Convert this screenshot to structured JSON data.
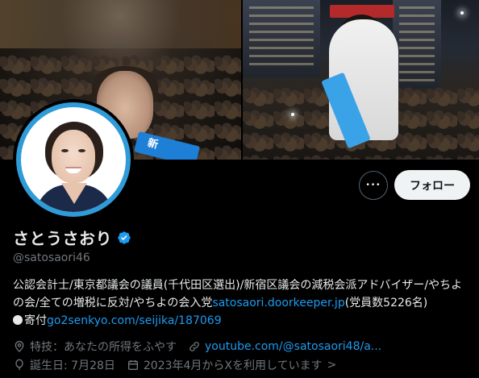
{
  "profile": {
    "display_name": "さとうさおり",
    "handle": "@satosaori46",
    "verified": true,
    "follow_label": "フォロー",
    "more_label": "•••"
  },
  "banner": {
    "left_sash_text": "新"
  },
  "bio": {
    "text1": "公認会計士/東京都議会の議員(千代田区選出)/新宿区議会の減税会派アドバイザー/やちよの会/全ての増税に反対/やちよの会入党",
    "link1": "satosaori.doorkeeper.jp",
    "text2": "(党員数5226名)",
    "text3": "寄付",
    "link2": "go2senkyo.com/seijika/187069"
  },
  "meta": {
    "location": "特技：あなたの所得をふやす",
    "website": "youtube.com/@satosaori48/a...",
    "birthday": "誕生日: 7月28日",
    "joined": "2023年4月からXを利用しています",
    "joined_chevron": ">"
  },
  "colors": {
    "background": "#000000",
    "accent": "#1d9bf0",
    "muted": "#71767b",
    "follow_bg": "#eff3f4"
  },
  "icons": [
    "more-icon",
    "verified-badge-icon",
    "location-icon",
    "link-icon",
    "calendar-icon",
    "chevron-right-icon"
  ]
}
